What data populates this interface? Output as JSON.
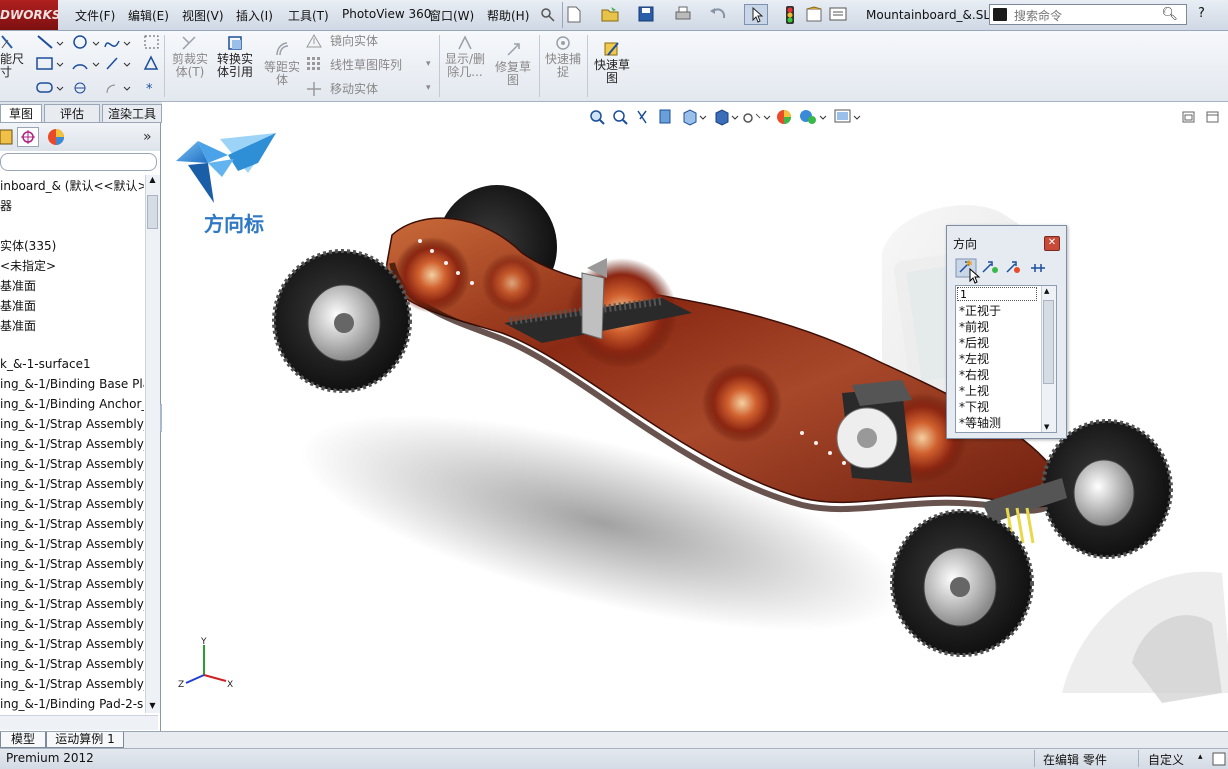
{
  "app": {
    "logo_text": "DWORKS"
  },
  "menu": [
    "文件(F)",
    "编辑(E)",
    "视图(V)",
    "插入(I)",
    "工具(T)",
    "PhotoView 360",
    "窗口(W)",
    "帮助(H)"
  ],
  "document_title": "Mountainboard_&.SL...",
  "search": {
    "placeholder": "搜索命令"
  },
  "help_label": "?",
  "command_manager": {
    "smart_dimension": "能尺\n寸",
    "trim_entities": "剪裁实\n体(T)",
    "convert_entities": "转换实\n体引用",
    "offset_entities": "等距实\n体",
    "mirror_entities": "镜向实体",
    "linear_pattern": "线性草图阵列",
    "move_entities": "移动实体",
    "show_delete_relations": "显示/删\n除几...",
    "repair_sketch": "修复草\n图",
    "quick_snaps": "快速捕\n捉",
    "rapid_sketch": "快速草\n图"
  },
  "command_tabs": [
    "草图",
    "评估",
    "渲染工具"
  ],
  "feature_tree": {
    "items": [
      "inboard_&  (默认<<默认>",
      "器",
      "",
      "实体(335)",
      " <未指定>",
      "基准面",
      "基准面",
      "基准面",
      "",
      "k_&-1-surface1",
      "ing_&-1/Binding Base Pla",
      "ing_&-1/Binding Anchor_",
      "ing_&-1/Strap Assembly_",
      "ing_&-1/Strap Assembly_",
      "ing_&-1/Strap Assembly_",
      "ing_&-1/Strap Assembly_",
      "ing_&-1/Strap Assembly_",
      "ing_&-1/Strap Assembly_",
      "ing_&-1/Strap Assembly_",
      "ing_&-1/Strap Assembly_",
      "ing_&-1/Strap Assembly_",
      "ing_&-1/Strap Assembly_",
      "ing_&-1/Strap Assembly_",
      "ing_&-1/Strap Assembly_",
      "ing_&-1/Strap Assembly_",
      "ing_&-1/Strap Assembly_",
      "ing_&-1/Binding Pad-2-s"
    ]
  },
  "watermark": {
    "text": "方向标"
  },
  "orientation_dialog": {
    "title": "方向",
    "input_value": "1",
    "views": [
      "*正视于",
      "*前视",
      "*后视",
      "*左视",
      "*右视",
      "*上视",
      "*下视",
      "*等轴测"
    ]
  },
  "triad": {
    "x": "X",
    "y": "Y",
    "z": "Z"
  },
  "bottom_tabs": [
    "模型",
    "运动算例 1"
  ],
  "status": {
    "left": "Premium 2012",
    "editing": "在编辑 零件",
    "custom": "自定义"
  },
  "colors": {
    "title_bar": "#cfd8e4",
    "logo_red": "#9a1818",
    "board_red": "#8a2a14",
    "accent_blue": "#2f8fd6"
  }
}
